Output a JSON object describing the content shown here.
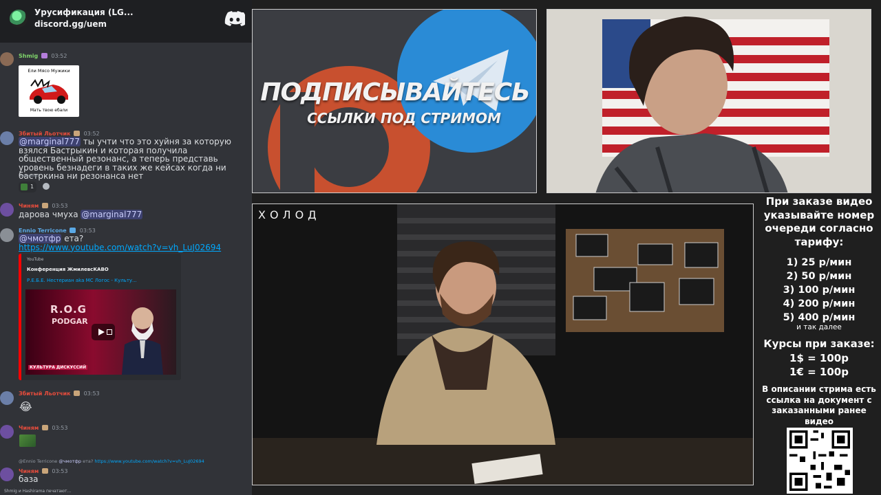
{
  "discord": {
    "server_name": "Урусификация (LG...",
    "invite": "discord.gg/uem",
    "messages": [
      {
        "author": "Shmig",
        "time": "03:52",
        "author_color": "#7fd46a",
        "image_caption_top": "Ели Мясо Мужики",
        "image_caption_bottom": "Мать твою ебали"
      },
      {
        "author": "Збитый Льотчик",
        "time": "03:52",
        "author_color": "#e74c3c",
        "mention": "@marginal777",
        "text": "ты учти что это хуйня за которую взялся Бастрыкин и которая получила общественный резонанс, а теперь представь уровень безнадеги в таких же кейсах когда ни бастркина ни резонанса нет",
        "edited": "(изменено)",
        "reaction_count": "1"
      },
      {
        "author": "Чиням",
        "time": "03:53",
        "author_color": "#e74c3c",
        "text": "дарова чмуха",
        "mention": "@marginal777"
      },
      {
        "author": "Ennio Terricone",
        "time": "03:53",
        "author_color": "#5aa9e6",
        "mention": "@чмотфр",
        "text": "ета?",
        "url": "https://www.youtube.com/watch?v=vh_LuJ02694",
        "embed": {
          "provider": "YouTube",
          "channel": "Конференция ЖмилевсКАВО",
          "title": "Р.Е.Б.Е. Нестериан aka МС Логос - Культу...",
          "thumb_line1": "R.O.G",
          "thumb_line2": "PODGAR",
          "thumb_banner": "КУЛЬТУРА ДИСКУССИЙ"
        }
      },
      {
        "author": "Збитый Льотчик",
        "time": "03:53",
        "author_color": "#e74c3c",
        "emoji": "😂"
      },
      {
        "author": "Чиням",
        "time": "03:53",
        "author_color": "#e74c3c"
      },
      {
        "author": "Чиням",
        "time": "03:53",
        "author_color": "#e74c3c",
        "reply_author": "@Ennio Terricone",
        "reply_mention": "@чмотфр",
        "reply_text": "ета?",
        "reply_url": "https://www.youtube.com/watch?v=vh_LuJ02694",
        "text": "база"
      }
    ],
    "typing": "Shmig и Hashirama печатают..."
  },
  "overlay": {
    "promo_line1": "ПОДПИСЫВАЙТЕСЬ",
    "promo_line2": "ССЫЛКИ ПОД СТРИМОМ",
    "video_logo": "ХОЛОД",
    "order_heading": "При заказе видео указывайте номер очереди согласно тарифу:",
    "tariffs": [
      "1) 25 р/мин",
      "2) 50 р/мин",
      "3) 100 р/мин",
      "4) 200 р/мин",
      "5) 400 р/мин"
    ],
    "and_more": "и так далее",
    "rates_heading": "Курсы при заказе:",
    "rate_usd": "1$ = 100р",
    "rate_eur": "1€ = 100р",
    "doc_note": "В описании стрима есть ссылка на документ с заказанными ранее видео"
  },
  "colors": {
    "discord_bg": "#313338",
    "header_bg": "#1e1f22",
    "mention_bg": "#3c4270",
    "link": "#00a8fc",
    "youtube_red": "#ff0000",
    "telegram_blue": "#2a8bd6",
    "patreon_orange": "#c8502f"
  }
}
